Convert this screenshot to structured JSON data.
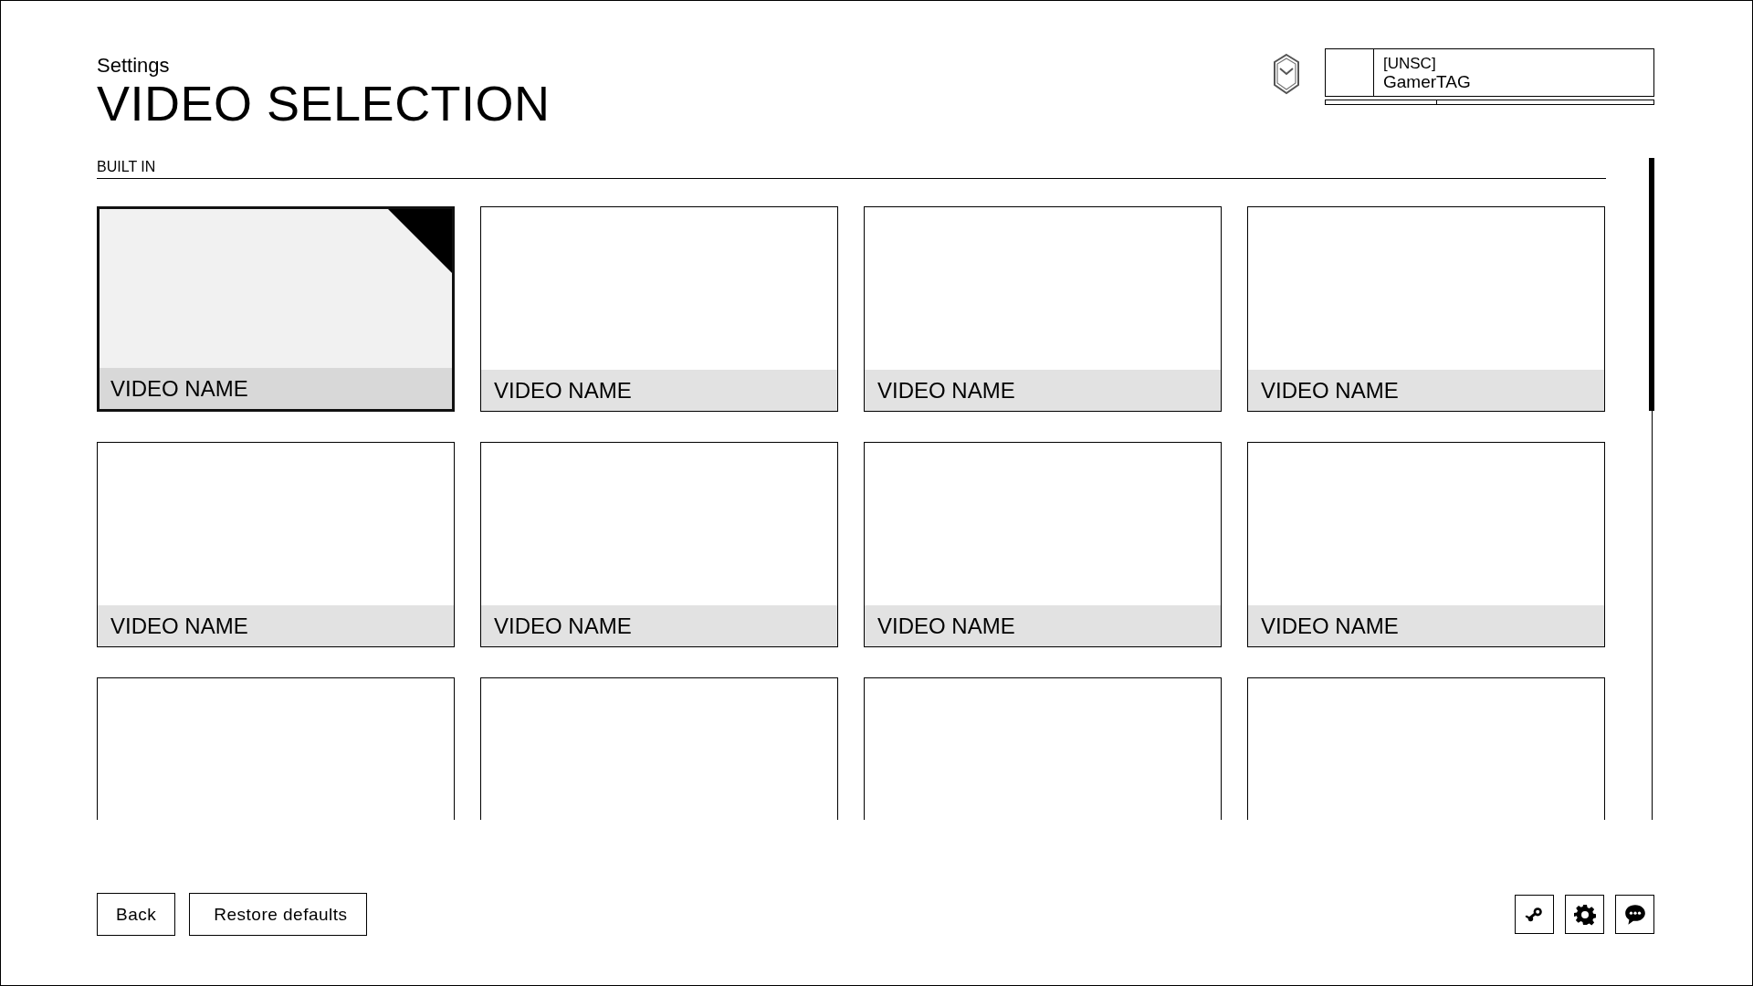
{
  "header": {
    "breadcrumb": "Settings",
    "title": "VIDEO SELECTION"
  },
  "profile": {
    "tag": "[UNSC]",
    "gamertag": "GamerTAG",
    "level": 0.34
  },
  "section": {
    "label": "BUILT IN"
  },
  "videos": [
    {
      "name": "VIDEO NAME",
      "selected": true
    },
    {
      "name": "VIDEO NAME",
      "selected": false
    },
    {
      "name": "VIDEO NAME",
      "selected": false
    },
    {
      "name": "VIDEO NAME",
      "selected": false
    },
    {
      "name": "VIDEO NAME",
      "selected": false
    },
    {
      "name": "VIDEO NAME",
      "selected": false
    },
    {
      "name": "VIDEO NAME",
      "selected": false
    },
    {
      "name": "VIDEO NAME",
      "selected": false
    },
    {
      "selected": false
    },
    {
      "selected": false
    },
    {
      "selected": false
    },
    {
      "selected": false
    }
  ],
  "footer": {
    "buttons": [
      "Back",
      "Restore defaults"
    ],
    "icons": [
      {
        "kind": "lever"
      },
      {
        "kind": "settings"
      },
      {
        "kind": "chat"
      }
    ]
  }
}
